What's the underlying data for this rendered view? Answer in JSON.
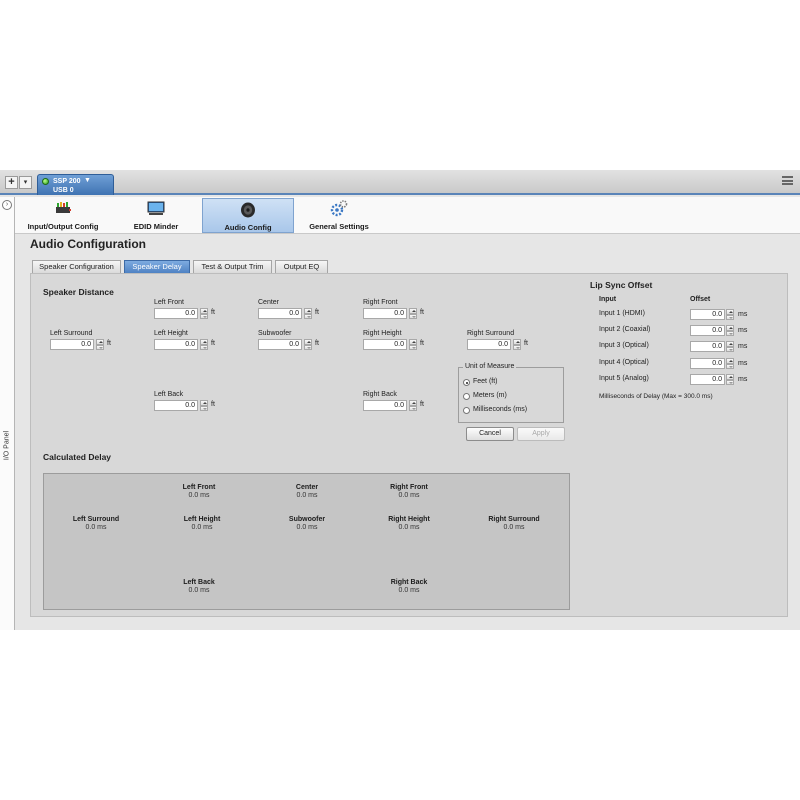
{
  "device": {
    "name": "SSP 200",
    "port": "USB 0"
  },
  "left_panel": {
    "label": "I/O Panel",
    "toggle": "›"
  },
  "toolbar": {
    "add_label": "+",
    "items": [
      {
        "label": "Input/Output Config",
        "icon": "io-config-icon"
      },
      {
        "label": "EDID Minder",
        "icon": "monitor-icon"
      },
      {
        "label": "Audio Config",
        "icon": "speaker-icon"
      },
      {
        "label": "General Settings",
        "icon": "gears-icon"
      }
    ],
    "active": "Audio Config"
  },
  "page_title": "Audio Configuration",
  "tabs": [
    {
      "label": "Speaker Configuration"
    },
    {
      "label": "Speaker Delay"
    },
    {
      "label": "Test & Output Trim"
    },
    {
      "label": "Output EQ"
    }
  ],
  "active_tab": "Speaker Delay",
  "speaker_distance": {
    "title": "Speaker Distance",
    "unit": "ft",
    "fields": {
      "left_front": {
        "label": "Left Front",
        "value": "0.0"
      },
      "center": {
        "label": "Center",
        "value": "0.0"
      },
      "right_front": {
        "label": "Right Front",
        "value": "0.0"
      },
      "left_surround": {
        "label": "Left Surround",
        "value": "0.0"
      },
      "left_height": {
        "label": "Left Height",
        "value": "0.0"
      },
      "subwoofer": {
        "label": "Subwoofer",
        "value": "0.0"
      },
      "right_height": {
        "label": "Right Height",
        "value": "0.0"
      },
      "right_surround": {
        "label": "Right Surround",
        "value": "0.0"
      },
      "left_back": {
        "label": "Left Back",
        "value": "0.0"
      },
      "right_back": {
        "label": "Right Back",
        "value": "0.0"
      }
    }
  },
  "unit_of_measure": {
    "title": "Unit of Measure",
    "options": [
      "Feet (ft)",
      "Meters (m)",
      "Milliseconds (ms)"
    ],
    "selected": "Feet (ft)"
  },
  "buttons": {
    "cancel": "Cancel",
    "apply": "Apply"
  },
  "calculated_delay": {
    "title": "Calculated Delay",
    "items": {
      "left_front": {
        "label": "Left Front",
        "value": "0.0 ms"
      },
      "center": {
        "label": "Center",
        "value": "0.0 ms"
      },
      "right_front": {
        "label": "Right Front",
        "value": "0.0 ms"
      },
      "left_surround": {
        "label": "Left Surround",
        "value": "0.0 ms"
      },
      "left_height": {
        "label": "Left Height",
        "value": "0.0 ms"
      },
      "subwoofer": {
        "label": "Subwoofer",
        "value": "0.0 ms"
      },
      "right_height": {
        "label": "Right Height",
        "value": "0.0 ms"
      },
      "right_surround": {
        "label": "Right Surround",
        "value": "0.0 ms"
      },
      "left_back": {
        "label": "Left Back",
        "value": "0.0 ms"
      },
      "right_back": {
        "label": "Right Back",
        "value": "0.0 ms"
      }
    }
  },
  "lip_sync": {
    "title": "Lip Sync Offset",
    "col_input": "Input",
    "col_offset": "Offset",
    "unit": "ms",
    "rows": [
      {
        "input": "Input 1 (HDMI)",
        "value": "0.0"
      },
      {
        "input": "Input 2 (Coaxial)",
        "value": "0.0"
      },
      {
        "input": "Input 3 (Optical)",
        "value": "0.0"
      },
      {
        "input": "Input 4 (Optical)",
        "value": "0.0"
      },
      {
        "input": "Input 5 (Analog)",
        "value": "0.0"
      }
    ],
    "note": "Milliseconds of Delay (Max = 300.0 ms)"
  },
  "colors": {
    "accent": "#4f82c3",
    "panel": "#d8d8d8",
    "delay_box": "#c5c5c5"
  }
}
